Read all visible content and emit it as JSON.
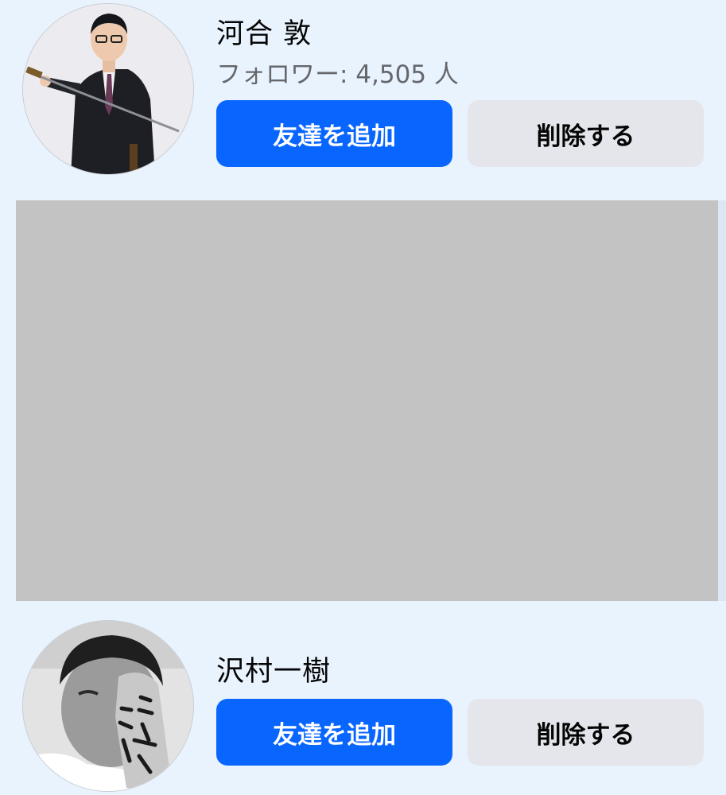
{
  "suggestions": [
    {
      "name": "河合 敦",
      "followers": "フォロワー: 4,505 人",
      "add_label": "友達を追加",
      "remove_label": "削除する"
    },
    {
      "name": "沢村一樹",
      "add_label": "友達を追加",
      "remove_label": "削除する"
    }
  ],
  "colors": {
    "page_background": "#e9f3fe",
    "primary_button": "#0866ff",
    "secondary_button": "#e4e6eb",
    "ad_placeholder": "#c3c3c3"
  }
}
